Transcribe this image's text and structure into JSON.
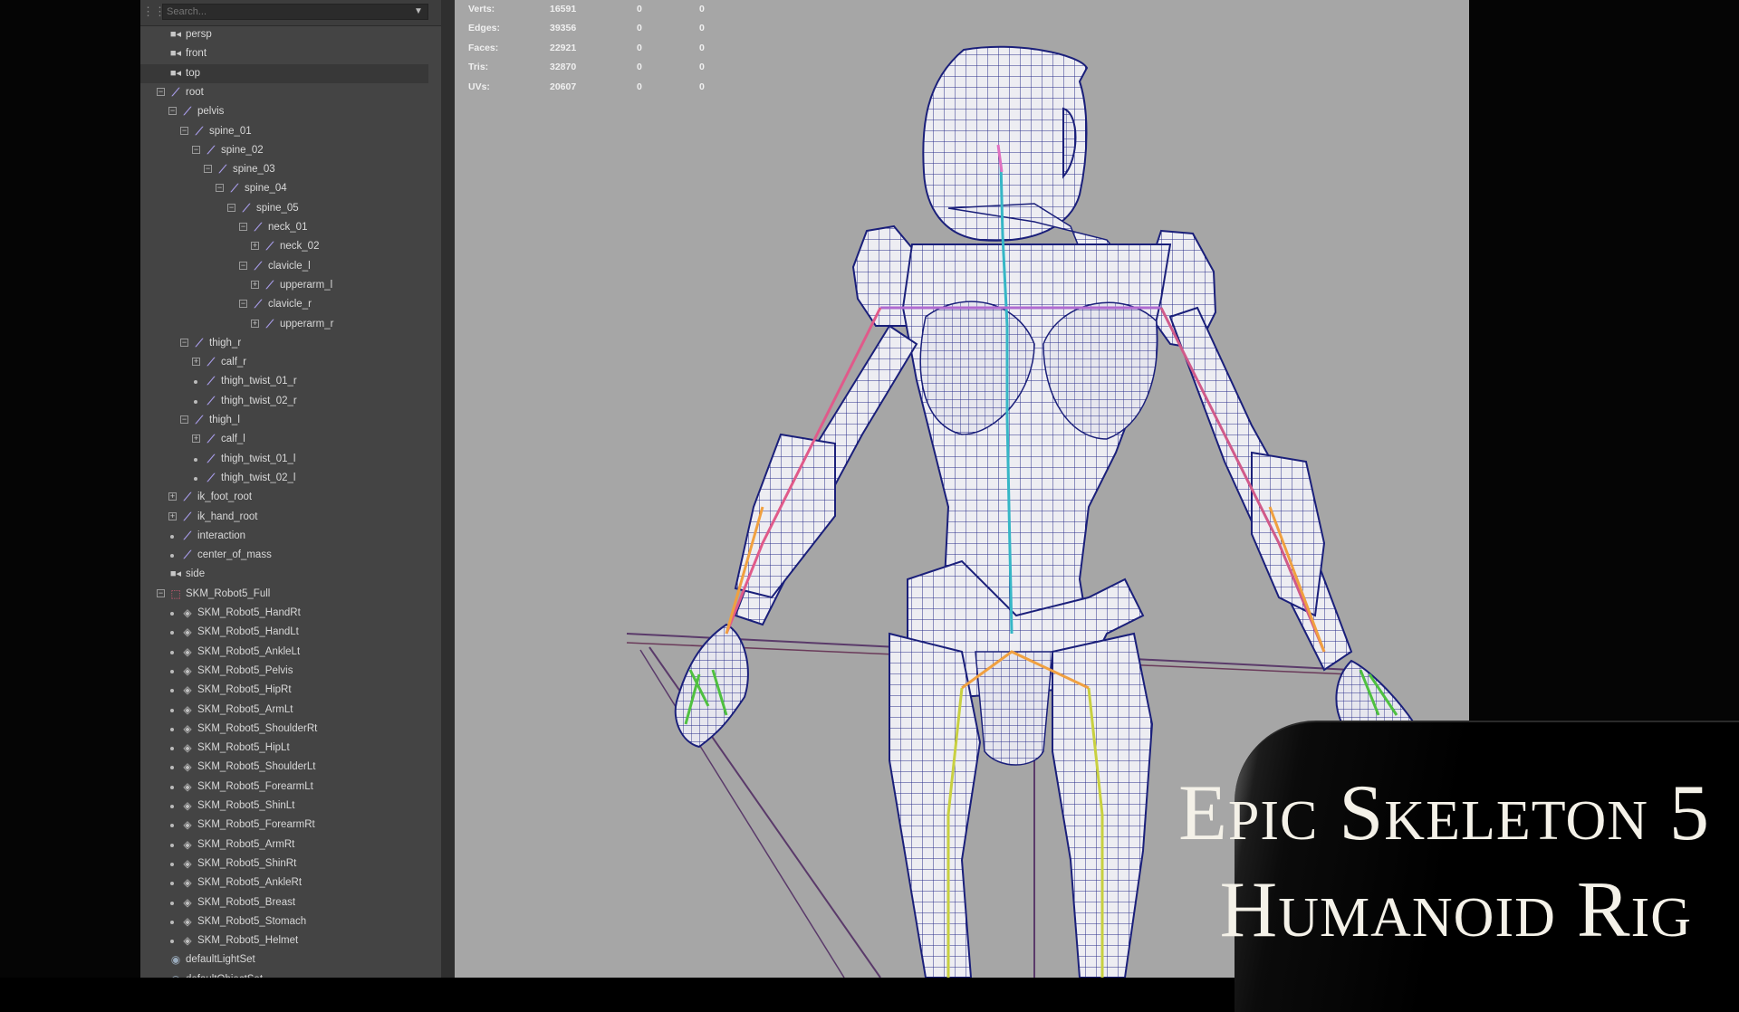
{
  "outliner": {
    "search_placeholder": "Search...",
    "items": [
      {
        "label": "persp",
        "depth": 0,
        "icon": "camera-icon",
        "expander": "none"
      },
      {
        "label": "front",
        "depth": 0,
        "icon": "camera-icon",
        "expander": "none"
      },
      {
        "label": "top",
        "depth": 0,
        "icon": "camera-icon",
        "expander": "none",
        "selected": true
      },
      {
        "label": "root",
        "depth": 0,
        "icon": "joint-icon",
        "expander": "minus"
      },
      {
        "label": "pelvis",
        "depth": 1,
        "icon": "joint-icon",
        "expander": "minus"
      },
      {
        "label": "spine_01",
        "depth": 2,
        "icon": "joint-icon",
        "expander": "minus"
      },
      {
        "label": "spine_02",
        "depth": 3,
        "icon": "joint-icon",
        "expander": "minus"
      },
      {
        "label": "spine_03",
        "depth": 4,
        "icon": "joint-icon",
        "expander": "minus"
      },
      {
        "label": "spine_04",
        "depth": 5,
        "icon": "joint-icon",
        "expander": "minus"
      },
      {
        "label": "spine_05",
        "depth": 6,
        "icon": "joint-icon",
        "expander": "minus"
      },
      {
        "label": "neck_01",
        "depth": 7,
        "icon": "joint-icon",
        "expander": "minus"
      },
      {
        "label": "neck_02",
        "depth": 8,
        "icon": "joint-icon",
        "expander": "plus"
      },
      {
        "label": "clavicle_l",
        "depth": 7,
        "icon": "joint-icon",
        "expander": "minus"
      },
      {
        "label": "upperarm_l",
        "depth": 8,
        "icon": "joint-icon",
        "expander": "plus"
      },
      {
        "label": "clavicle_r",
        "depth": 7,
        "icon": "joint-icon",
        "expander": "minus"
      },
      {
        "label": "upperarm_r",
        "depth": 8,
        "icon": "joint-icon",
        "expander": "plus"
      },
      {
        "label": "thigh_r",
        "depth": 2,
        "icon": "joint-icon",
        "expander": "minus"
      },
      {
        "label": "calf_r",
        "depth": 3,
        "icon": "joint-icon",
        "expander": "plus"
      },
      {
        "label": "thigh_twist_01_r",
        "depth": 3,
        "icon": "joint-icon",
        "expander": "dot"
      },
      {
        "label": "thigh_twist_02_r",
        "depth": 3,
        "icon": "joint-icon",
        "expander": "dot"
      },
      {
        "label": "thigh_l",
        "depth": 2,
        "icon": "joint-icon",
        "expander": "minus"
      },
      {
        "label": "calf_l",
        "depth": 3,
        "icon": "joint-icon",
        "expander": "plus"
      },
      {
        "label": "thigh_twist_01_l",
        "depth": 3,
        "icon": "joint-icon",
        "expander": "dot"
      },
      {
        "label": "thigh_twist_02_l",
        "depth": 3,
        "icon": "joint-icon",
        "expander": "dot"
      },
      {
        "label": "ik_foot_root",
        "depth": 1,
        "icon": "joint-icon",
        "expander": "plus"
      },
      {
        "label": "ik_hand_root",
        "depth": 1,
        "icon": "joint-icon",
        "expander": "plus"
      },
      {
        "label": "interaction",
        "depth": 1,
        "icon": "joint-icon",
        "expander": "dot"
      },
      {
        "label": "center_of_mass",
        "depth": 1,
        "icon": "joint-icon",
        "expander": "dot"
      },
      {
        "label": "side",
        "depth": 0,
        "icon": "camera-icon",
        "expander": "none"
      },
      {
        "label": "SKM_Robot5_Full",
        "depth": 0,
        "icon": "group-icon",
        "expander": "minus"
      },
      {
        "label": "SKM_Robot5_HandRt",
        "depth": 1,
        "icon": "mesh-icon",
        "expander": "dot"
      },
      {
        "label": "SKM_Robot5_HandLt",
        "depth": 1,
        "icon": "mesh-icon",
        "expander": "dot"
      },
      {
        "label": "SKM_Robot5_AnkleLt",
        "depth": 1,
        "icon": "mesh-icon",
        "expander": "dot"
      },
      {
        "label": "SKM_Robot5_Pelvis",
        "depth": 1,
        "icon": "mesh-icon",
        "expander": "dot"
      },
      {
        "label": "SKM_Robot5_HipRt",
        "depth": 1,
        "icon": "mesh-icon",
        "expander": "dot"
      },
      {
        "label": "SKM_Robot5_ArmLt",
        "depth": 1,
        "icon": "mesh-icon",
        "expander": "dot"
      },
      {
        "label": "SKM_Robot5_ShoulderRt",
        "depth": 1,
        "icon": "mesh-icon",
        "expander": "dot"
      },
      {
        "label": "SKM_Robot5_HipLt",
        "depth": 1,
        "icon": "mesh-icon",
        "expander": "dot"
      },
      {
        "label": "SKM_Robot5_ShoulderLt",
        "depth": 1,
        "icon": "mesh-icon",
        "expander": "dot"
      },
      {
        "label": "SKM_Robot5_ForearmLt",
        "depth": 1,
        "icon": "mesh-icon",
        "expander": "dot"
      },
      {
        "label": "SKM_Robot5_ShinLt",
        "depth": 1,
        "icon": "mesh-icon",
        "expander": "dot"
      },
      {
        "label": "SKM_Robot5_ForearmRt",
        "depth": 1,
        "icon": "mesh-icon",
        "expander": "dot"
      },
      {
        "label": "SKM_Robot5_ArmRt",
        "depth": 1,
        "icon": "mesh-icon",
        "expander": "dot"
      },
      {
        "label": "SKM_Robot5_ShinRt",
        "depth": 1,
        "icon": "mesh-icon",
        "expander": "dot"
      },
      {
        "label": "SKM_Robot5_AnkleRt",
        "depth": 1,
        "icon": "mesh-icon",
        "expander": "dot"
      },
      {
        "label": "SKM_Robot5_Breast",
        "depth": 1,
        "icon": "mesh-icon",
        "expander": "dot"
      },
      {
        "label": "SKM_Robot5_Stomach",
        "depth": 1,
        "icon": "mesh-icon",
        "expander": "dot"
      },
      {
        "label": "SKM_Robot5_Helmet",
        "depth": 1,
        "icon": "mesh-icon",
        "expander": "dot"
      },
      {
        "label": "defaultLightSet",
        "depth": 0,
        "icon": "set-icon",
        "expander": "none"
      },
      {
        "label": "defaultObjectSet",
        "depth": 0,
        "icon": "set-icon",
        "expander": "none"
      }
    ]
  },
  "viewport": {
    "hud": [
      {
        "label": "Verts:",
        "v1": "16591",
        "v2": "0",
        "v3": "0"
      },
      {
        "label": "Edges:",
        "v1": "39356",
        "v2": "0",
        "v3": "0"
      },
      {
        "label": "Faces:",
        "v1": "22921",
        "v2": "0",
        "v3": "0"
      },
      {
        "label": "Tris:",
        "v1": "32870",
        "v2": "0",
        "v3": "0"
      },
      {
        "label": "UVs:",
        "v1": "20607",
        "v2": "0",
        "v3": "0"
      }
    ],
    "background_color": "#a6a6a6",
    "wireframe_color": "#1a1f7a"
  },
  "title_plate": {
    "line1": "Epic Skeleton 5",
    "line2": "Humanoid Rig"
  }
}
